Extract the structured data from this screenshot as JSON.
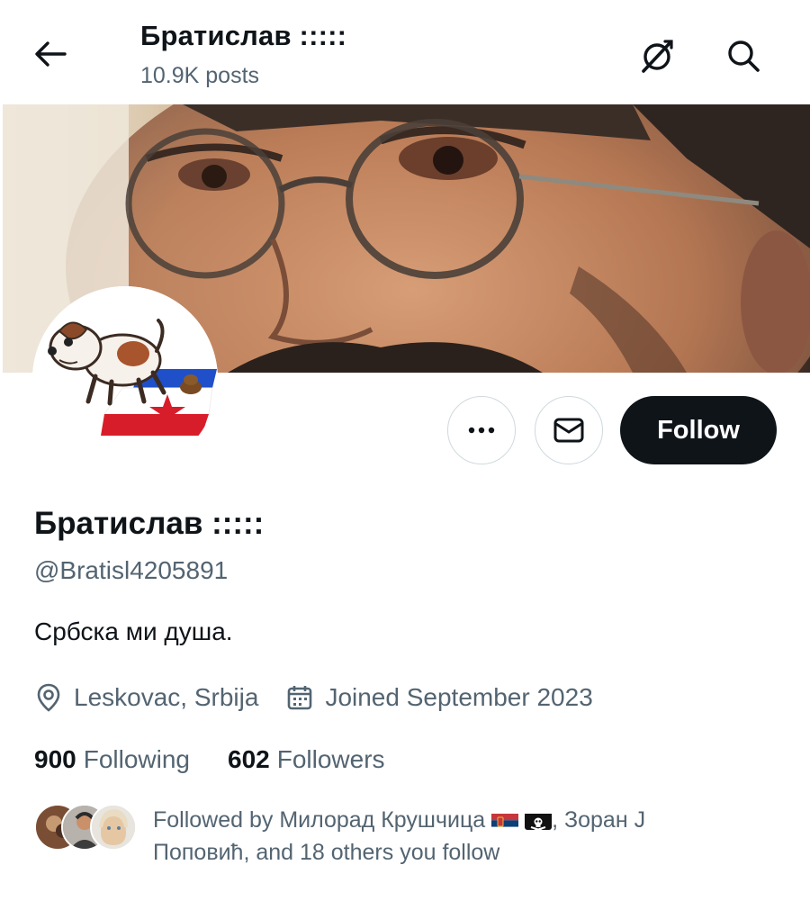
{
  "header": {
    "title": "Братислав :::::",
    "posts_count": "10.9K posts",
    "back_icon": "back-arrow-icon",
    "grok_icon": "grok-icon",
    "search_icon": "search-icon"
  },
  "profile": {
    "display_name": "Братислав :::::",
    "handle": "@Bratisl4205891",
    "bio": "Србска ми душа.",
    "location": "Leskovac, Srbija",
    "joined": "Joined September 2023",
    "following_count": "900",
    "following_label": "Following",
    "followers_count": "602",
    "followers_label": "Followers"
  },
  "actions": {
    "more_icon": "more-icon",
    "message_icon": "envelope-icon",
    "follow_label": "Follow"
  },
  "followed_by": {
    "text_prefix": "Followed by Милорад Крушчица",
    "text_suffix": ", Зоран J Поповић, and 18 others you follow"
  },
  "colors": {
    "text_primary": "#0f1419",
    "text_secondary": "#536471",
    "button_dark": "#0f1419",
    "border": "#cfd9de"
  }
}
